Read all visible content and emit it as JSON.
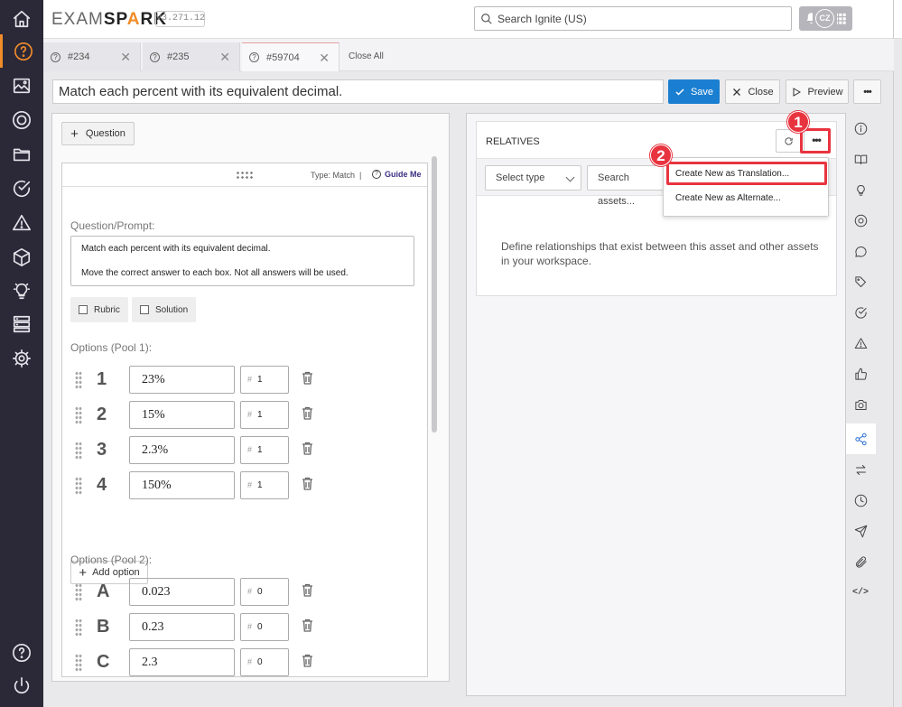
{
  "app": {
    "logo_a": "EXAM",
    "logo_b": "SP",
    "logo_c": "A",
    "logo_d": "RK",
    "version": "v3.271.12",
    "search_placeholder": "Search Ignite (US)",
    "avatar_initials": "CZ"
  },
  "tabs": [
    {
      "label": "#234"
    },
    {
      "label": "#235"
    },
    {
      "label": "#59704"
    }
  ],
  "close_all_label": "Close All",
  "title": "Match each percent with its equivalent decimal.",
  "toolbar": {
    "save": "Save",
    "close": "Close",
    "preview": "Preview",
    "more": "•••"
  },
  "editor": {
    "question_btn": "Question",
    "type_label": "Type: Match",
    "guide_me": "Guide Me",
    "prompt_label": "Question/Prompt:",
    "prompt_line1": "Match each percent with its equivalent decimal.",
    "prompt_line2": "Move the correct answer to each box. Not all answers will be used.",
    "rubric": "Rubric",
    "solution": "Solution",
    "pool1_label": "Options (Pool 1):",
    "pool1": [
      {
        "key": "1",
        "value": "23%",
        "num": "1"
      },
      {
        "key": "2",
        "value": "15%",
        "num": "1"
      },
      {
        "key": "3",
        "value": "2.3%",
        "num": "1"
      },
      {
        "key": "4",
        "value": "150%",
        "num": "1"
      }
    ],
    "add_option": "Add option",
    "pool2_label": "Options (Pool 2):",
    "pool2": [
      {
        "key": "A",
        "value": "0.023",
        "num": "0"
      },
      {
        "key": "B",
        "value": "0.23",
        "num": "0"
      },
      {
        "key": "C",
        "value": "2.3",
        "num": "0"
      }
    ]
  },
  "relatives": {
    "title": "RELATIVES",
    "more": "•••",
    "select_type": "Select type",
    "search_assets": "Search assets...",
    "description": "Define relationships that exist between this asset and other assets in your workspace.",
    "menu": [
      "Create New as Translation...",
      "Create New as Alternate..."
    ]
  },
  "callouts": [
    "1",
    "2"
  ],
  "colors": {
    "accent": "#f08c2a",
    "primary": "#1b7fd1",
    "highlight": "#e8343f",
    "nav_bg": "#2b2838"
  }
}
